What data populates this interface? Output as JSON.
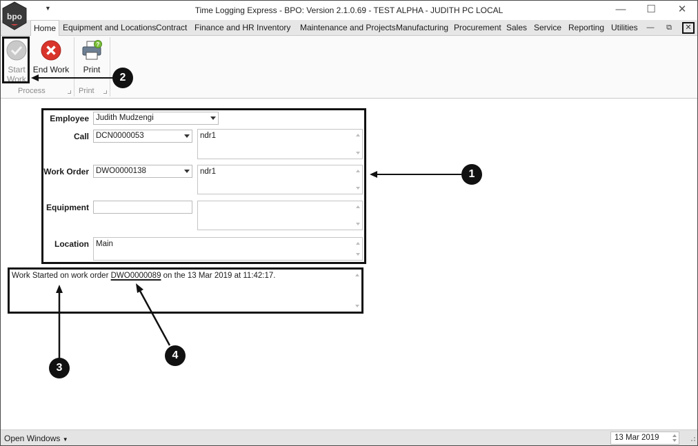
{
  "window": {
    "title": "Time Logging Express - BPO: Version 2.1.0.69 - TEST ALPHA - JUDITH PC LOCAL",
    "logo_text": "bpo",
    "minimize_icon": "minimize-icon",
    "maximize_icon": "maximize-icon",
    "close_icon": "close-icon"
  },
  "menu": {
    "tabs": [
      {
        "label": "Home",
        "active": true
      },
      {
        "label": "Equipment and Locations"
      },
      {
        "label": "Contract"
      },
      {
        "label": "Finance and HR"
      },
      {
        "label": "Inventory"
      },
      {
        "label": "Maintenance and Projects"
      },
      {
        "label": "Manufacturing"
      },
      {
        "label": "Procurement"
      },
      {
        "label": "Sales"
      },
      {
        "label": "Service"
      },
      {
        "label": "Reporting"
      },
      {
        "label": "Utilities"
      }
    ]
  },
  "ribbon": {
    "start_work": {
      "line1": "Start",
      "line2": "Work",
      "icon": "check-circle-icon",
      "enabled": false
    },
    "end_work": {
      "label": "End Work",
      "icon": "cancel-circle-icon"
    },
    "print": {
      "label": "Print",
      "icon": "printer-icon"
    },
    "groups": {
      "process": "Process",
      "print": "Print"
    }
  },
  "form": {
    "employee": {
      "label": "Employee",
      "value": "Judith Mudzengi"
    },
    "call": {
      "label": "Call",
      "value": "DCN0000053",
      "description": "ndr1"
    },
    "work_order": {
      "label": "Work Order",
      "value": "DWO0000138",
      "description": "ndr1"
    },
    "equipment": {
      "label": "Equipment",
      "value": "",
      "description": ""
    },
    "location": {
      "label": "Location",
      "value": "Main"
    }
  },
  "message": {
    "prefix": "Work Started on work order ",
    "work_order": "DWO0000089",
    "suffix": " on the 13 Mar 2019 at 11:42:17."
  },
  "callouts": [
    "1",
    "2",
    "3",
    "4"
  ],
  "statusbar": {
    "open_windows": "Open Windows",
    "date": "13 Mar 2019"
  },
  "colors": {
    "accent": "#111111",
    "ribbon_bg": "#fafafa",
    "tab_strip_bg": "#e6e6e6",
    "end_work_red": "#d9342b",
    "start_work_gray": "#9a9a9a"
  }
}
